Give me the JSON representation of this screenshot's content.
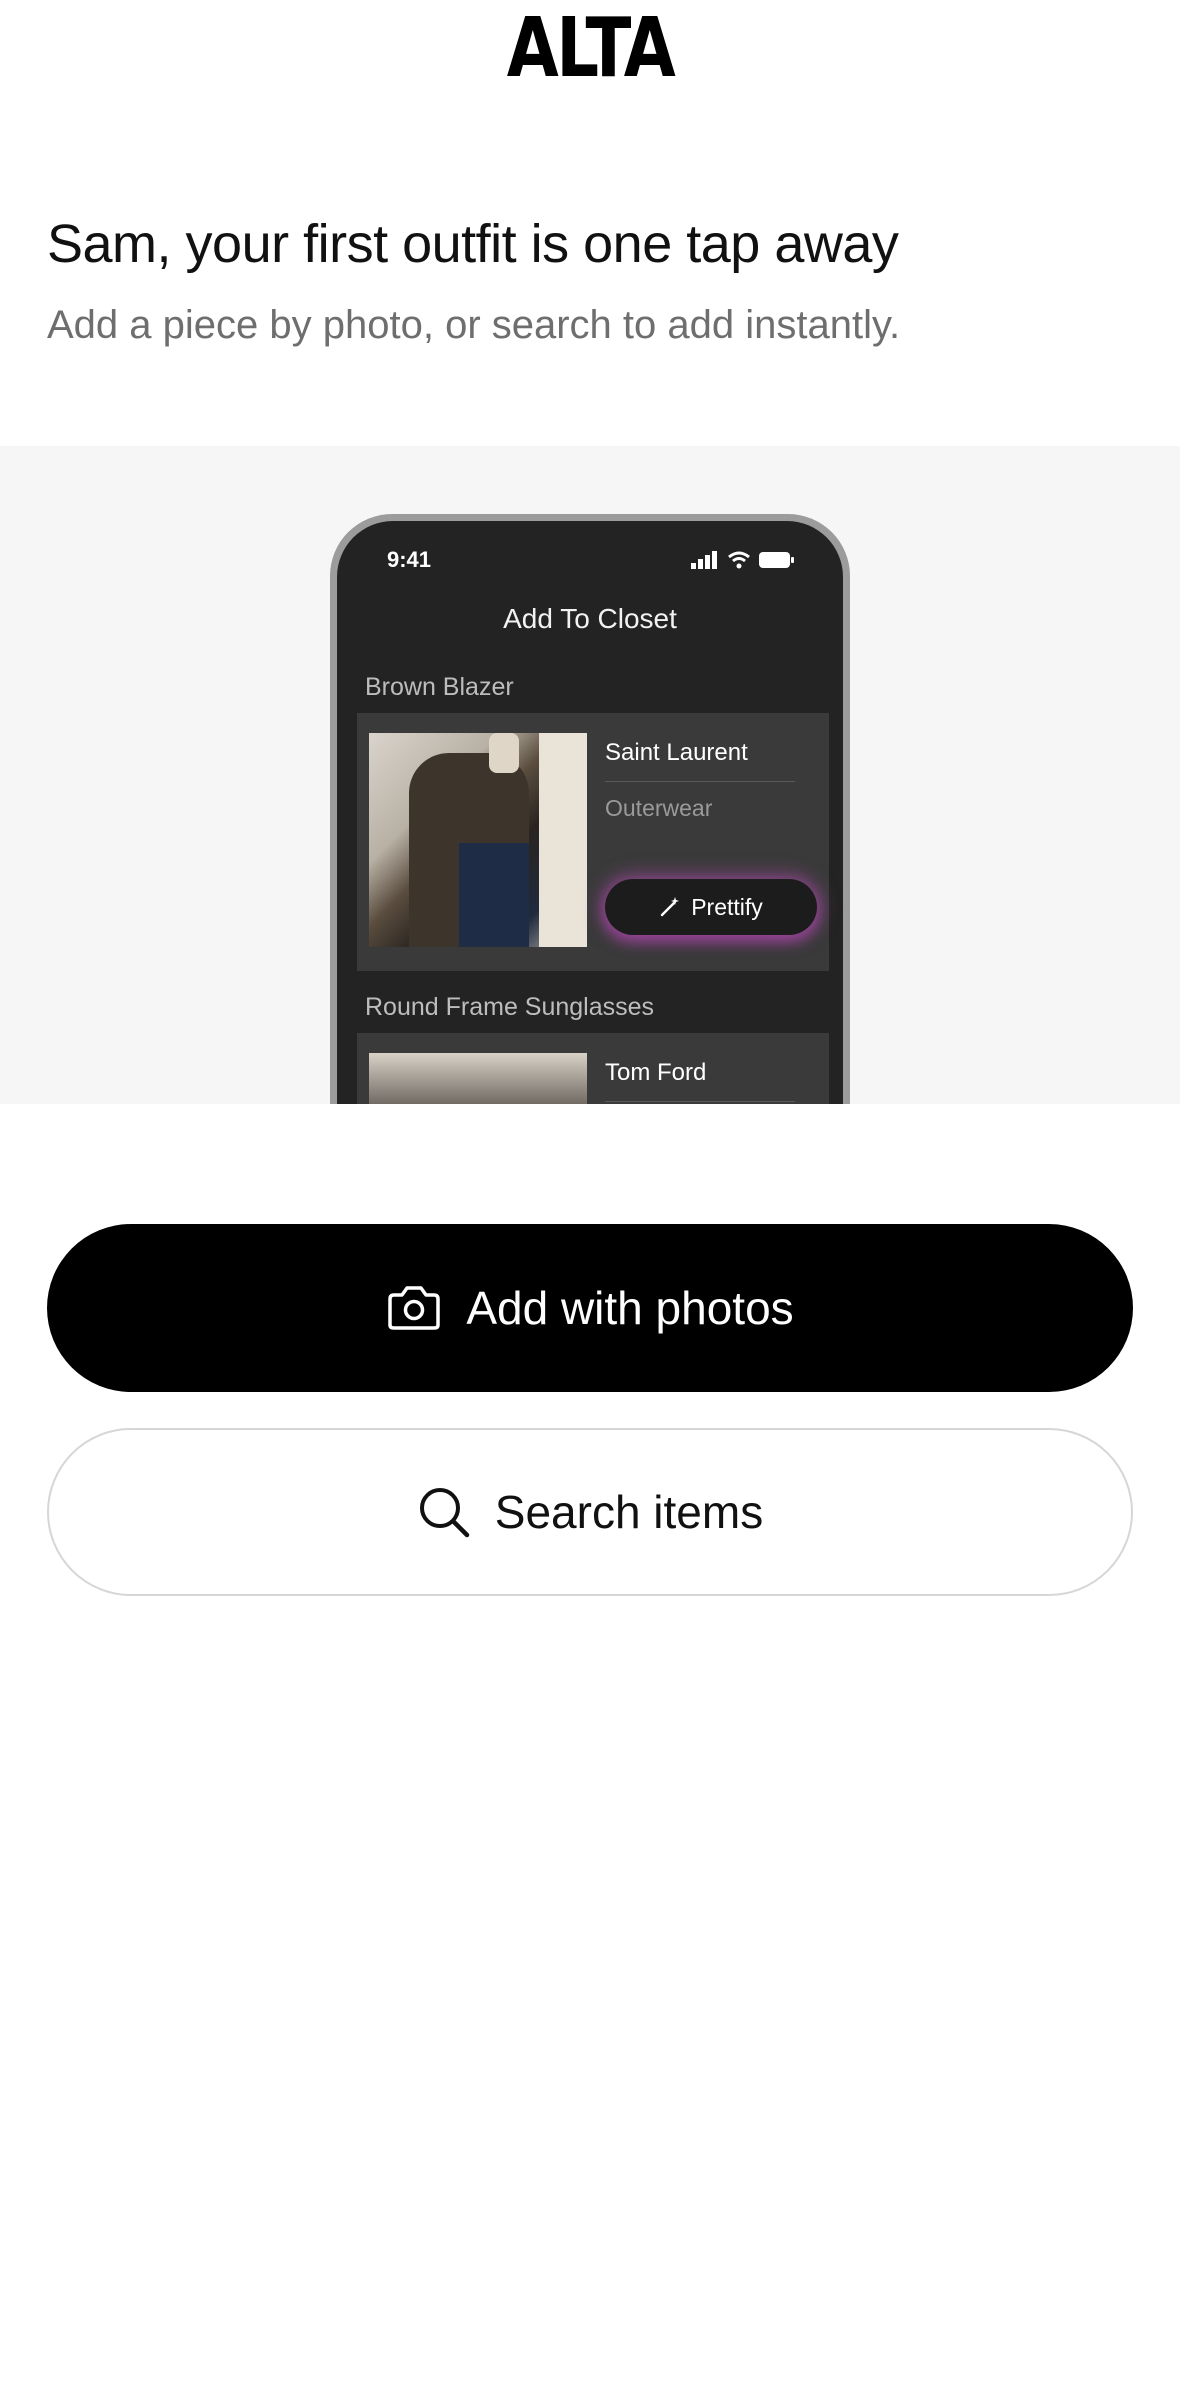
{
  "app": {
    "logo": "ALTA"
  },
  "intro": {
    "headline": "Sam, your first outfit is one tap away",
    "subhead": "Add a piece by photo, or search to add instantly."
  },
  "preview": {
    "status_time": "9:41",
    "screen_title": "Add To Closet",
    "items": [
      {
        "label": "Brown Blazer",
        "brand": "Saint Laurent",
        "category": "Outerwear",
        "action": "Prettify"
      },
      {
        "label": "Round Frame Sunglasses",
        "brand": "Tom Ford"
      }
    ]
  },
  "actions": {
    "primary_label": "Add with photos",
    "primary_icon": "camera-icon",
    "secondary_label": "Search items",
    "secondary_icon": "search-icon"
  },
  "colors": {
    "primary_button": "#000000",
    "secondary_border": "#d6d6d6",
    "prettify_glow": "#be50be"
  }
}
